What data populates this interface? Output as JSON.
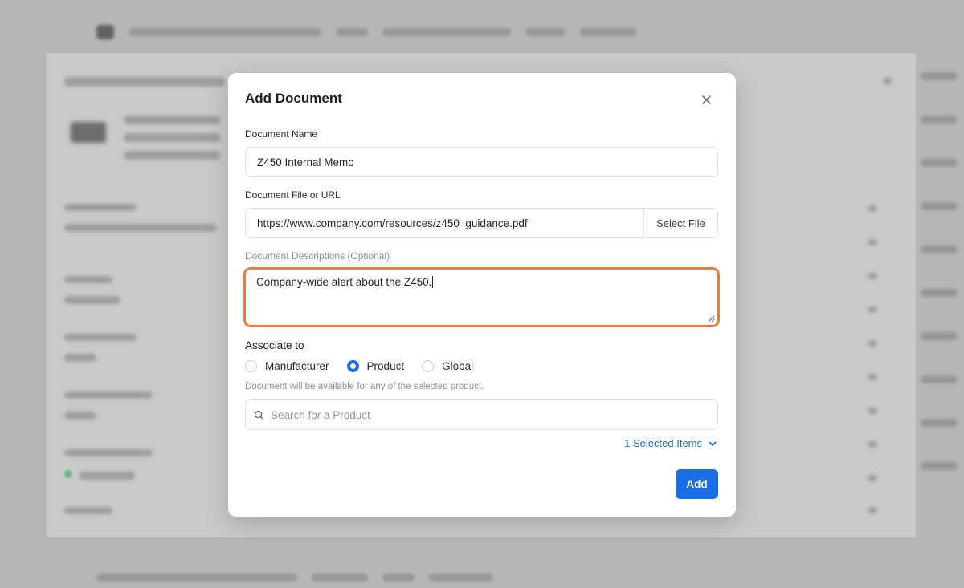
{
  "modal": {
    "title": "Add Document",
    "document_name": {
      "label": "Document Name",
      "value": "Z450 Internal Memo"
    },
    "document_file": {
      "label": "Document File or URL",
      "value": "https://www.company.com/resources/z450_guidance.pdf",
      "select_file_label": "Select File"
    },
    "description": {
      "label": "Document Descriptions (Optional)",
      "value": "Company-wide alert about the Z450."
    },
    "associate": {
      "label": "Associate to",
      "options": [
        {
          "label": "Manufacturer",
          "selected": false
        },
        {
          "label": "Product",
          "selected": true
        },
        {
          "label": "Global",
          "selected": false
        }
      ],
      "hint": "Document will be available for any of the selected product.",
      "search_placeholder": "Search for a Product",
      "selected_items_label": "1 Selected Items"
    },
    "add_label": "Add"
  },
  "colors": {
    "accent": "#1a6fe6",
    "focus_ring": "#f07a3e",
    "overlay": "#9a9a9a"
  },
  "icons": [
    "close-icon",
    "search-icon",
    "chevron-down-icon",
    "resize-grip-icon"
  ]
}
